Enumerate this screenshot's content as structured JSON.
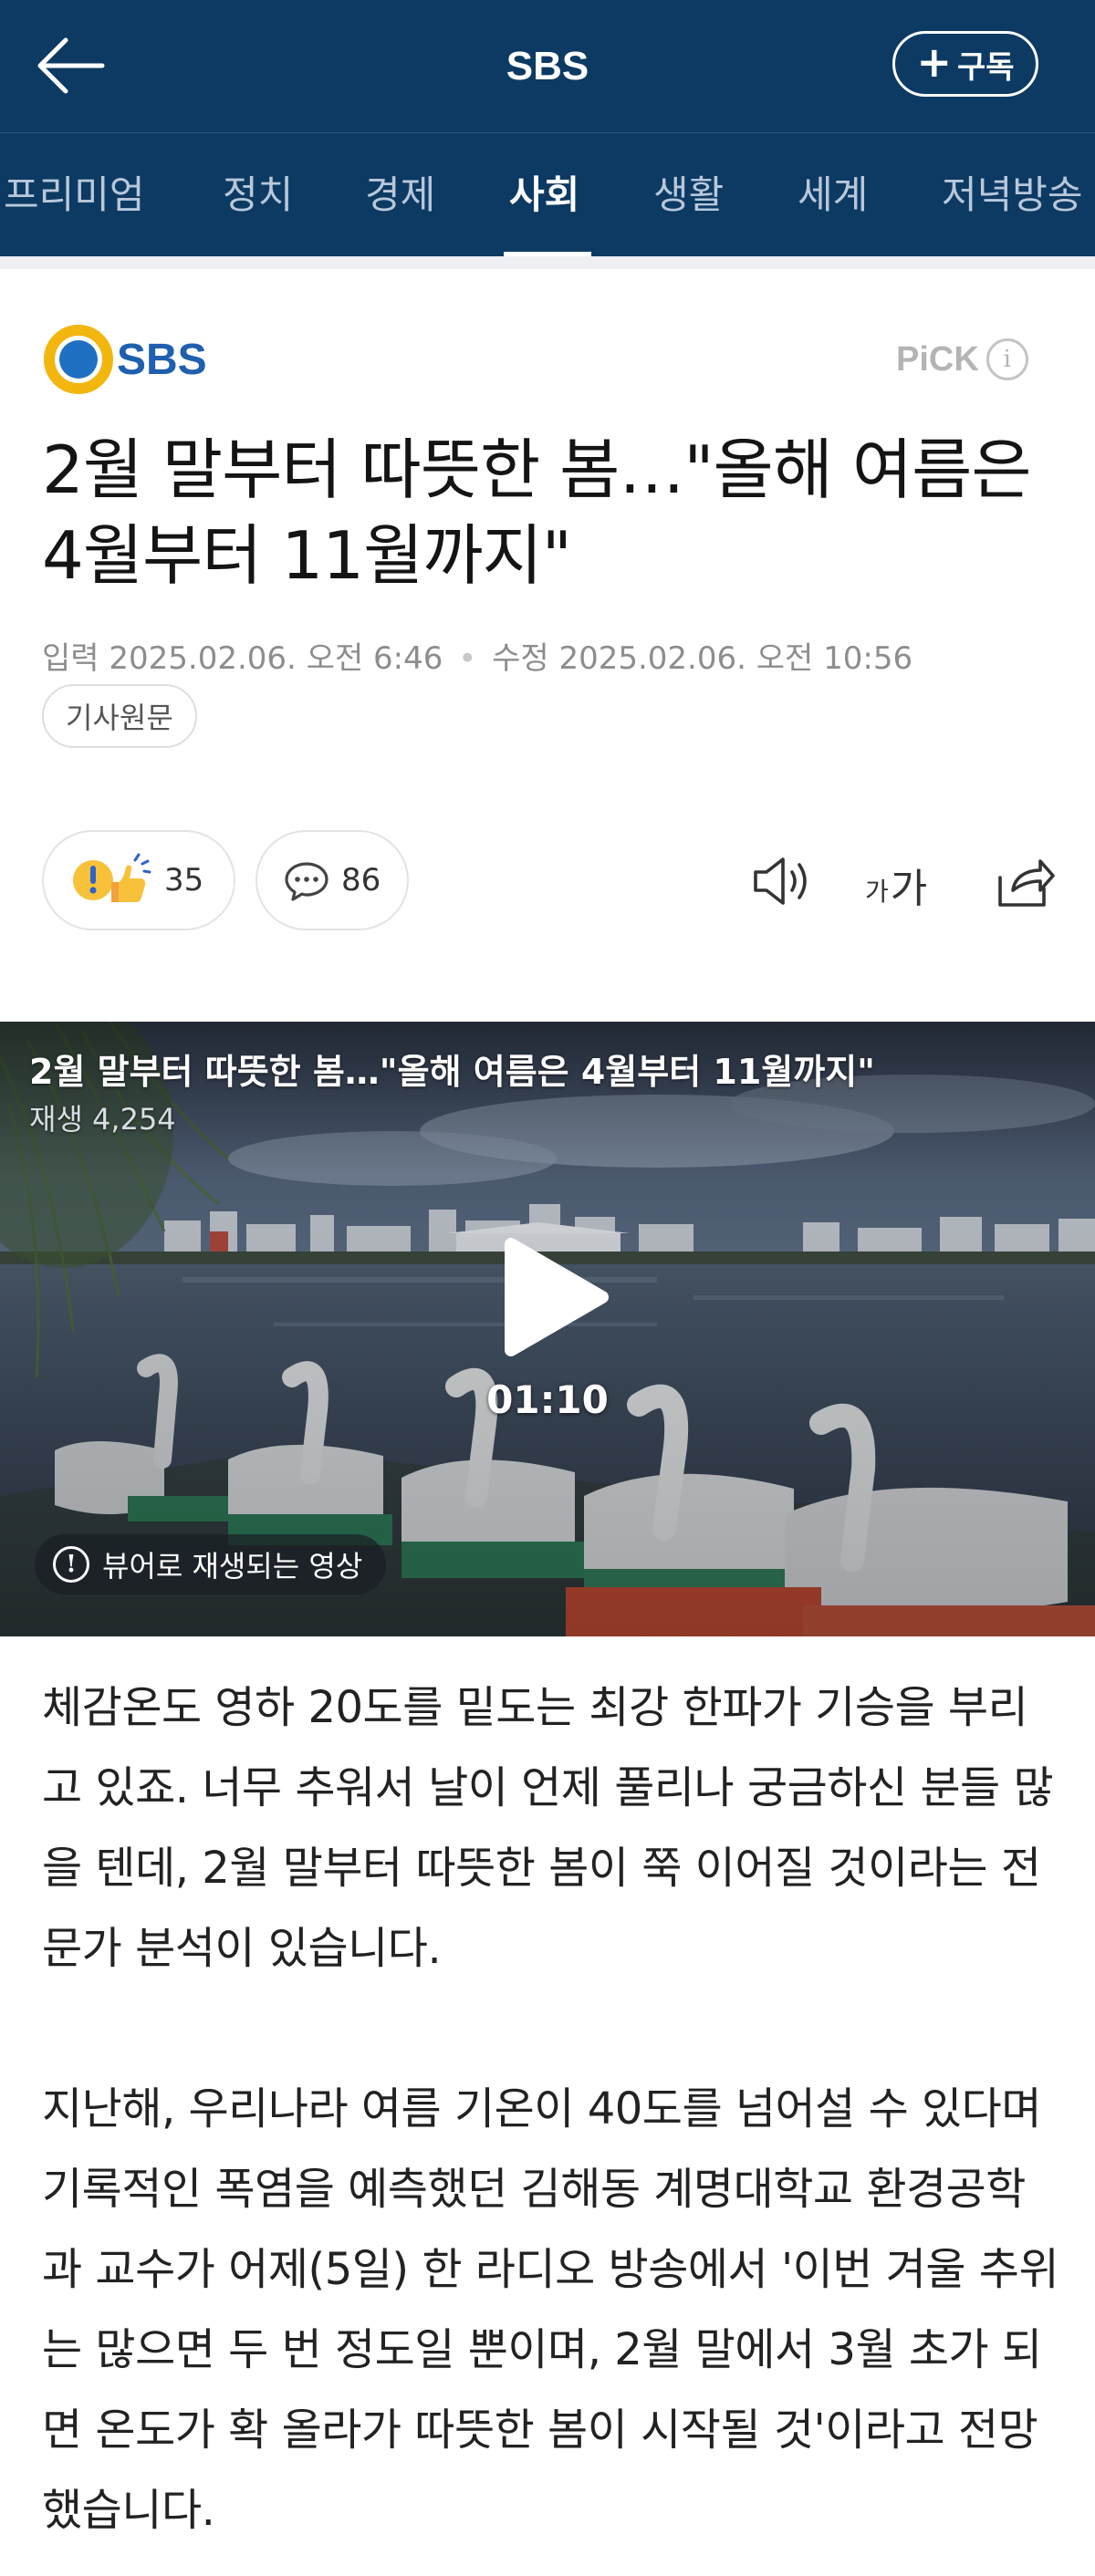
{
  "header": {
    "title": "SBS",
    "subscribe_label": "구독"
  },
  "tabs": [
    {
      "label": "프리미엄",
      "active": false
    },
    {
      "label": "정치",
      "active": false
    },
    {
      "label": "경제",
      "active": false
    },
    {
      "label": "사회",
      "active": true
    },
    {
      "label": "생활",
      "active": false
    },
    {
      "label": "세계",
      "active": false
    },
    {
      "label": "저녁방송",
      "active": false
    }
  ],
  "publisher": {
    "logo_text": "SBS",
    "pick_label": "PiCK",
    "pick_info": "i"
  },
  "article": {
    "headline": "2월 말부터 따뜻한 봄…\"올해 여름은 4월부터 11월까지\"",
    "published_label": "입력",
    "published": "2025.02.06. 오전 6:46",
    "modified_label": "수정",
    "modified": "2025.02.06. 오전 10:56",
    "original_button": "기사원문"
  },
  "actions": {
    "reaction_count": "35",
    "comment_count": "86",
    "font_small": "가",
    "font_big": "가"
  },
  "video": {
    "title": "2월 말부터 따뜻한 봄…\"올해 여름은 4월부터 11월까지\"",
    "plays": "재생 4,254",
    "duration": "01:10",
    "viewer_note": "뷰어로 재생되는 영상"
  },
  "body": {
    "paragraphs": [
      "체감온도 영하 20도를 밑도는 최강 한파가 기승을 부리고 있죠. 너무 추워서 날이 언제 풀리나 궁금하신 분들 많을 텐데, 2월 말부터 따뜻한 봄이 쭉 이어질 것이라는 전문가 분석이 있습니다.",
      "지난해, 우리나라 여름 기온이 40도를 넘어설 수 있다며 기록적인 폭염을 예측했던 김해동 계명대학교 환경공학과 교수가 어제(5일) 한 라디오 방송에서 '이번 겨울 추위는 많으면 두 번 정도일 뿐이며, 2월 말에서 3월 초가 되면 온도가 확 올라가 따뜻한 봄이 시작될 것'이라고 전망했습니다."
    ]
  },
  "colors": {
    "header_bg": "#0d3a63",
    "tab_inactive": "#b8c8da",
    "sbs_logo_ring": "#f3b60f",
    "sbs_logo_dot": "#1f6fc2",
    "sbs_text": "#1f5fae"
  },
  "icons": [
    "back-arrow-icon",
    "plus-icon",
    "info-icon",
    "reaction-icon",
    "comment-icon",
    "speaker-icon",
    "font-size-icon",
    "share-icon",
    "play-icon"
  ]
}
